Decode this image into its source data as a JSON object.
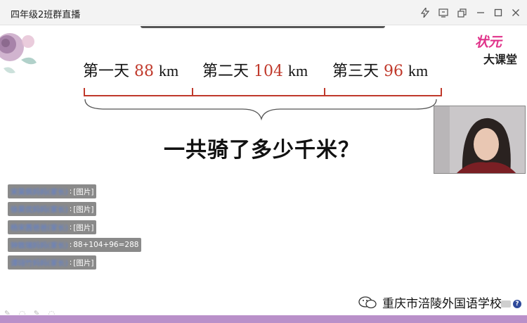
{
  "window": {
    "title": "四年级2班群直播",
    "controls": [
      "lightning-icon",
      "share-screen-icon",
      "restore-icon",
      "minimize-icon",
      "maximize-icon",
      "close-icon"
    ]
  },
  "slide": {
    "days": [
      {
        "label": "第一天",
        "value": "88",
        "unit": "km"
      },
      {
        "label": "第二天",
        "value": "104",
        "unit": "km"
      },
      {
        "label": "第三天",
        "value": "96",
        "unit": "km"
      }
    ],
    "question": "一共骑了多少千米？",
    "logo": {
      "top": "状元",
      "bottom": "大课堂"
    }
  },
  "chat": {
    "messages": [
      {
        "name": "宋昊佩妈妈(家长)",
        "text": "[图片]"
      },
      {
        "name": "徐昊优妈妈(家长)",
        "text": "[图片]"
      },
      {
        "name": "杨宋茜爸爸(家长)",
        "text": "[图片]"
      },
      {
        "name": "钟致瑞妈妈(家长)",
        "text": "88+104+96=288"
      },
      {
        "name": "谭翊竹妈妈(家长)",
        "text": "[图片]"
      }
    ],
    "separator": ":"
  },
  "watermark": {
    "text": "重庆市涪陵外国语学校"
  },
  "colors": {
    "accent_red": "#c0392b",
    "bottom_bar": "#b990c9",
    "chat_bg": "#8a8a8a",
    "logo_pink": "#e0338a"
  }
}
